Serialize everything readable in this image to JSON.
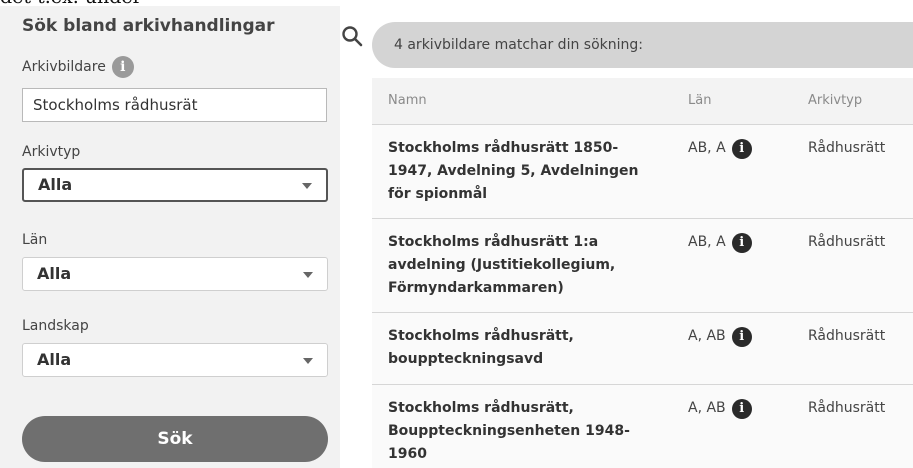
{
  "caption": "det t.ex. under",
  "search": {
    "title": "Sök bland arkivhandlingar",
    "arkivbildare_label": "Arkivbildare",
    "arkivbildare_value": "Stockholms rådhusrät",
    "arkivtyp_label": "Arkivtyp",
    "arkivtyp_value": "Alla",
    "lan_label": "Län",
    "lan_value": "Alla",
    "landskap_label": "Landskap",
    "landskap_value": "Alla",
    "search_button": "Sök",
    "info_glyph": "i"
  },
  "results": {
    "summary": "4 arkivbildare matchar din sökning:",
    "columns": {
      "namn": "Namn",
      "lan": "Län",
      "arkivtyp": "Arkivtyp"
    },
    "rows": [
      {
        "namn": "Stockholms rådhusrätt 1850-1947, Avdelning 5, Avdelningen för spionmål",
        "lan": "AB, A",
        "arkivtyp": "Rådhusrätt"
      },
      {
        "namn": "Stockholms rådhusrätt 1:a avdelning (Justitiekollegium, Förmyndarkammaren)",
        "lan": "AB, A",
        "arkivtyp": "Rådhusrätt"
      },
      {
        "namn": "Stockholms rådhusrätt, bouppteckningsavd",
        "lan": "A, AB",
        "arkivtyp": "Rådhusrätt"
      },
      {
        "namn": "Stockholms rådhusrätt, Bouppteckningsenheten 1948-1960",
        "lan": "A, AB",
        "arkivtyp": "Rådhusrätt"
      }
    ]
  },
  "icons": {
    "search": "search-icon",
    "info": "info-icon",
    "caret": "chevron-down-icon"
  }
}
